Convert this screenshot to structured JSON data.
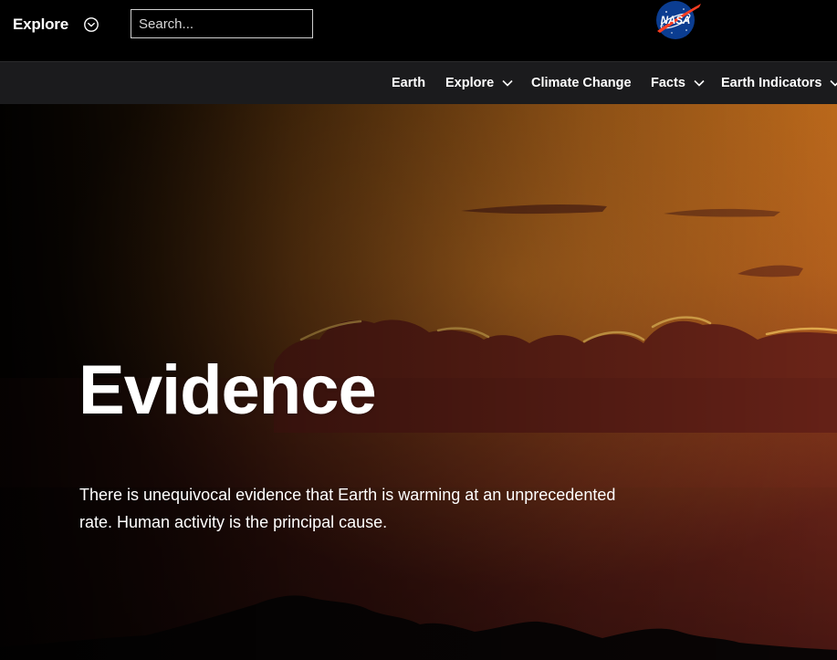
{
  "header": {
    "explore_label": "Explore",
    "explore_icon": "chevron-circle-down-icon",
    "search": {
      "placeholder": "Search...",
      "value": ""
    },
    "logo": {
      "text": "NASA",
      "icon": "nasa-meatball-logo"
    }
  },
  "nav": {
    "items": [
      {
        "label": "Earth",
        "has_dropdown": false
      },
      {
        "label": "Explore",
        "has_dropdown": true
      },
      {
        "label": "Climate Change",
        "has_dropdown": false
      },
      {
        "label": "Facts",
        "has_dropdown": true
      },
      {
        "label": "Earth Indicators",
        "has_dropdown": true
      }
    ]
  },
  "hero": {
    "title": "Evidence",
    "description": "There is unequivocal evidence that Earth is warming at an unprecedented rate. Human activity is the principal cause."
  },
  "colors": {
    "topbar": "#000000",
    "navbar": "#1b1b1d",
    "sky_top": "#b8661a",
    "sky_bottom": "#4a1712",
    "text": "#ffffff"
  }
}
